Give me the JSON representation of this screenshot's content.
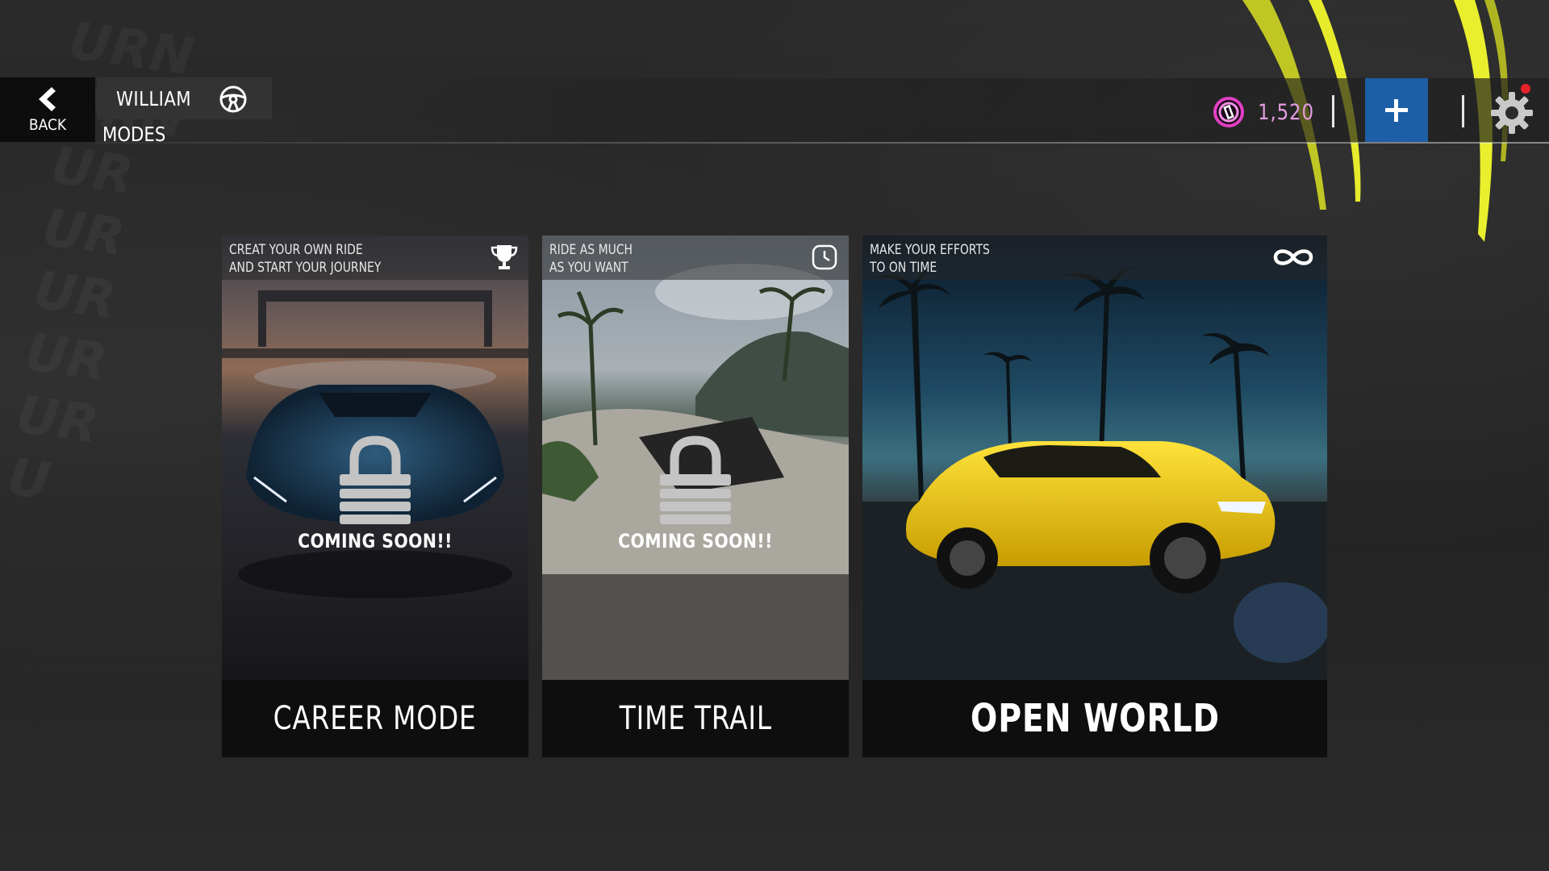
{
  "header": {
    "back_label": "BACK",
    "player_name": "WILLIAM",
    "page_title": "MODES",
    "currency_value": "1,520",
    "icons": {
      "back": "chevron-left-icon",
      "wheel": "steering-wheel-icon",
      "coin": "coin-icon",
      "add": "plus-icon",
      "settings": "gear-icon"
    },
    "accent_blue": "#1d5fa6",
    "coin_color": "#e39ce0"
  },
  "background": {
    "scrawl": "URN\nURN\nUR\nUR\nUR\nUR\nUR\nU"
  },
  "modes": [
    {
      "subtitle": "CREAT YOUR OWN RIDE\nAND START YOUR JOURNEY",
      "title": "CAREER MODE",
      "icon": "trophy-icon",
      "locked": true,
      "status": "COMING SOON!!"
    },
    {
      "subtitle": "RIDE AS MUCH\nAS YOU WANT",
      "title": "TIME TRAIL",
      "icon": "clock-icon",
      "locked": true,
      "status": "COMING SOON!!"
    },
    {
      "subtitle": "MAKE YOUR EFFORTS\nTO ON TIME",
      "title": "OPEN WORLD",
      "icon": "infinity-icon",
      "locked": false
    }
  ]
}
